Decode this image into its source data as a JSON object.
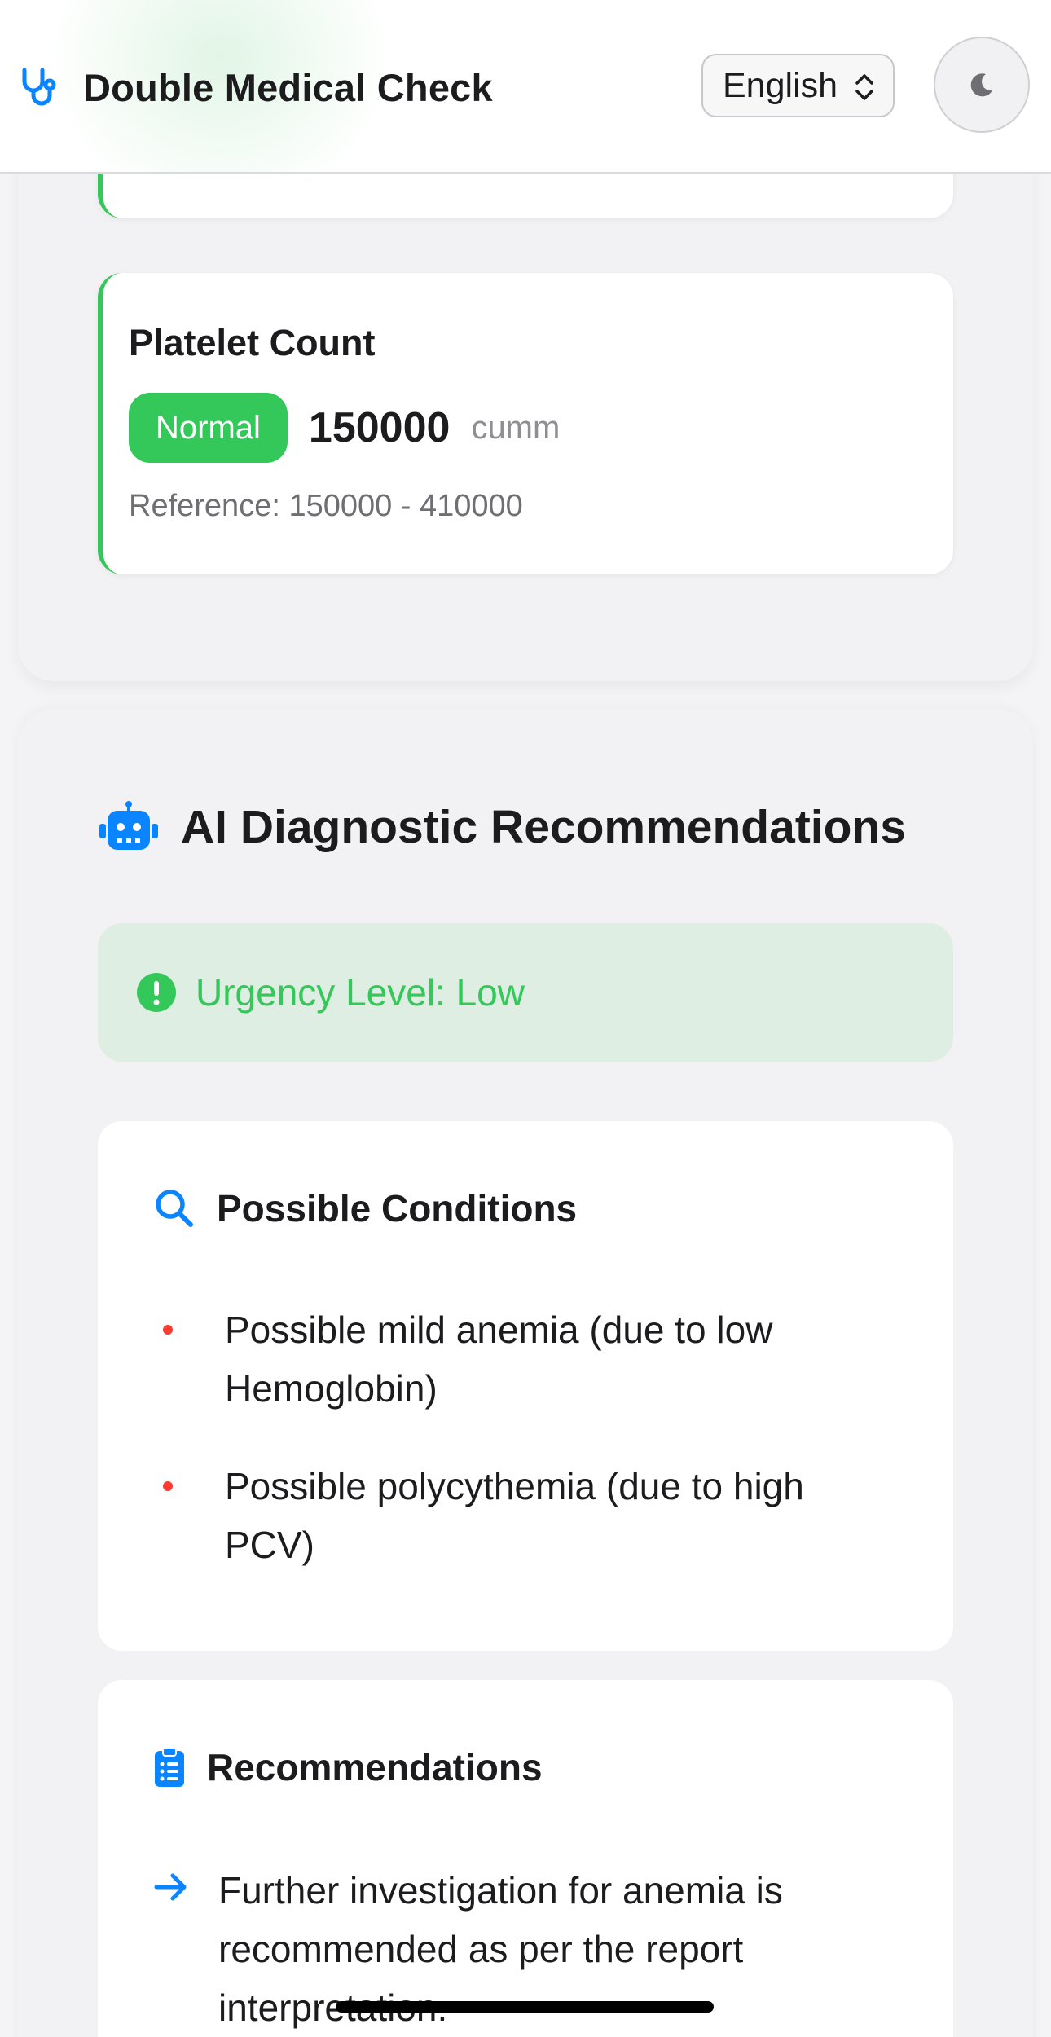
{
  "header": {
    "app_title": "Double Medical Check",
    "language": "English",
    "theme_toggle_icon": "moon-icon",
    "brand_icon": "stethoscope-icon",
    "accent": "#0a84ff"
  },
  "results": {
    "platelet": {
      "name": "Platelet Count",
      "status": "Normal",
      "value": "150000",
      "unit": "cumm",
      "reference": "Reference: 150000 - 410000",
      "status_color": "#34c759"
    }
  },
  "ai": {
    "title": "AI Diagnostic Recommendations",
    "title_icon": "robot-icon",
    "urgency": "Urgency Level: Low",
    "urgency_color": "#34c759",
    "conditions": {
      "heading": "Possible Conditions",
      "icon": "search-icon",
      "items": [
        "Possible mild anemia (due to low Hemoglobin)",
        "Possible polycythemia (due to high PCV)"
      ]
    },
    "recommendations": {
      "heading": "Recommendations",
      "icon": "clipboard-icon",
      "items": [
        "Further investigation for anemia is recommended as per the report interpretation."
      ]
    }
  }
}
